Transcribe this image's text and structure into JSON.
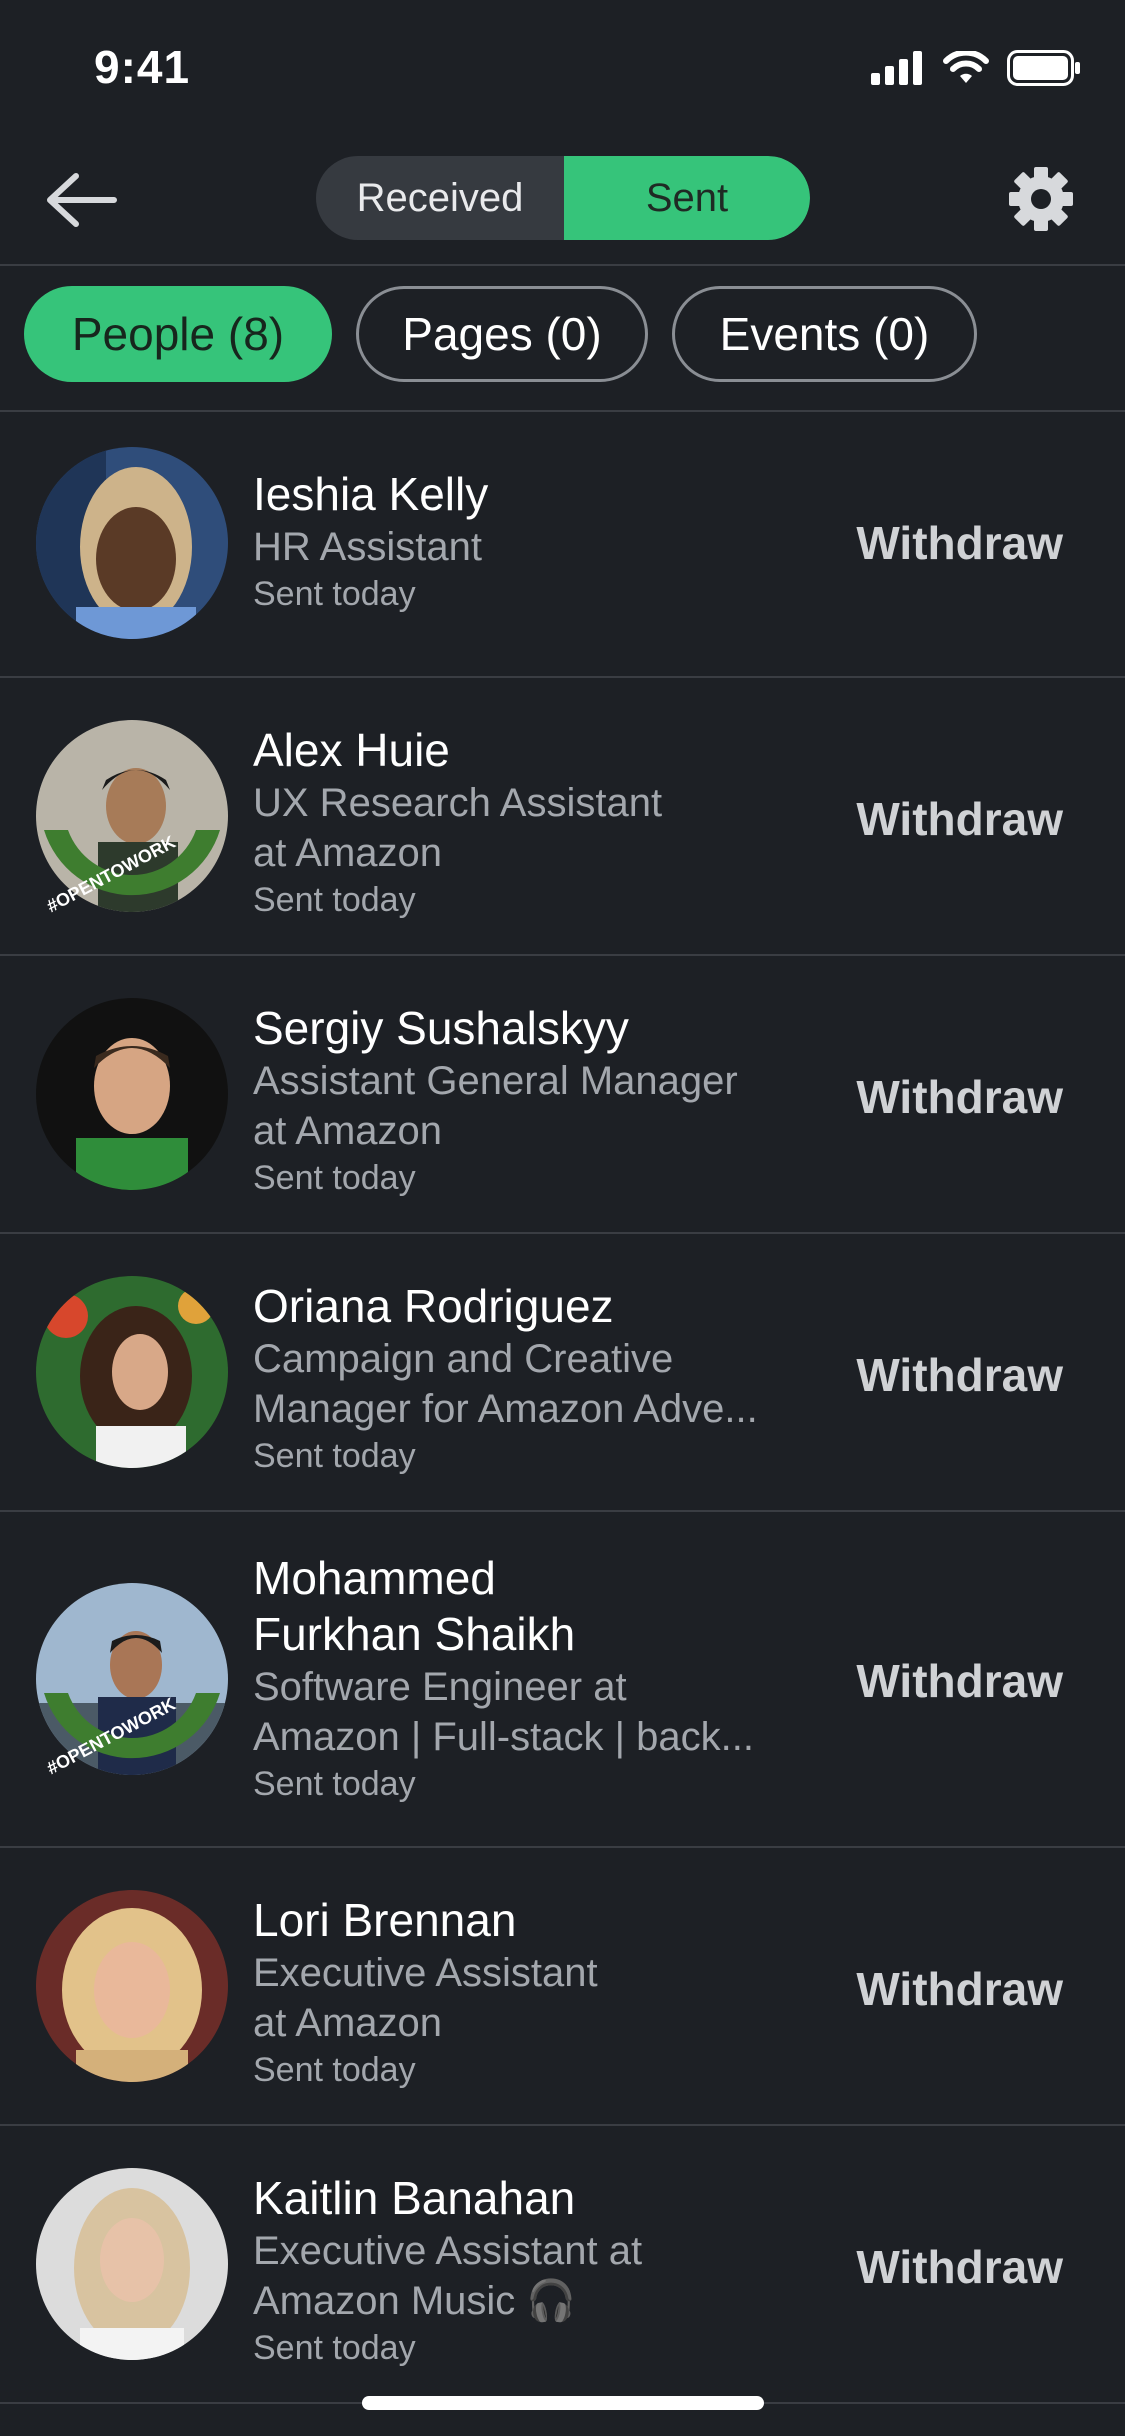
{
  "status": {
    "time": "9:41"
  },
  "nav": {
    "tabs": [
      {
        "label": "Received",
        "active": false
      },
      {
        "label": "Sent",
        "active": true
      }
    ]
  },
  "filters": [
    {
      "label": "People (8)",
      "active": true
    },
    {
      "label": "Pages (0)",
      "active": false
    },
    {
      "label": "Events (0)",
      "active": false
    }
  ],
  "withdraw_label": "Withdraw",
  "people": [
    {
      "name": "Ieshia Kelly",
      "title_lines": [
        "HR Assistant"
      ],
      "sent": "Sent today",
      "badge": ""
    },
    {
      "name": "Alex Huie",
      "title_lines": [
        "UX Research Assistant",
        "at Amazon"
      ],
      "sent": "Sent today",
      "badge": "#OPENTOWORK"
    },
    {
      "name": "Sergiy Sushalskyy",
      "title_lines": [
        "Assistant General Manager",
        "at Amazon"
      ],
      "sent": "Sent today",
      "badge": ""
    },
    {
      "name": "Oriana Rodriguez",
      "title_lines": [
        "Campaign and Creative",
        "Manager for Amazon Adve..."
      ],
      "sent": "Sent today",
      "badge": ""
    },
    {
      "name": "Mohammed Furkhan Shaikh",
      "name_lines": [
        "Mohammed",
        "Furkhan Shaikh"
      ],
      "title_lines": [
        "Software Engineer at",
        "Amazon | Full-stack | back..."
      ],
      "sent": "Sent today",
      "badge": "#OPENTOWORK"
    },
    {
      "name": "Lori Brennan",
      "title_lines": [
        "Executive Assistant",
        "at Amazon"
      ],
      "sent": "Sent today",
      "badge": ""
    },
    {
      "name": "Kaitlin Banahan",
      "title_lines": [
        "Executive Assistant at",
        "Amazon Music 🎧"
      ],
      "sent": "Sent today",
      "badge": ""
    }
  ]
}
